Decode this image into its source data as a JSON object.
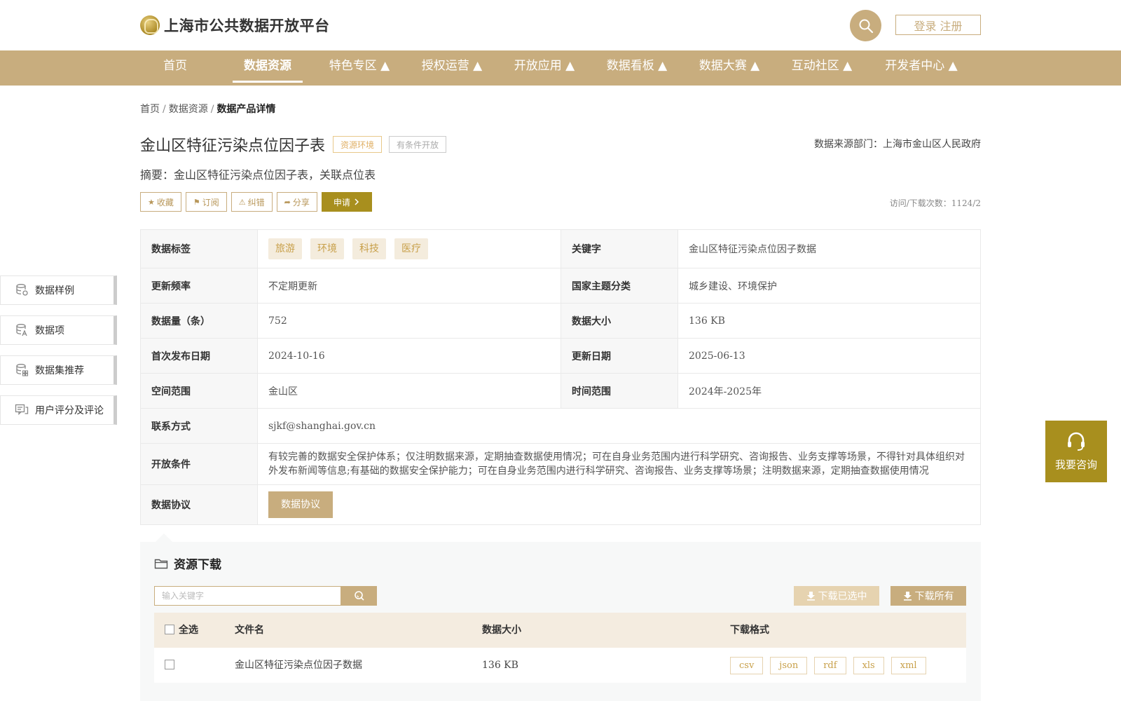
{
  "header": {
    "site_title": "上海市公共数据开放平台",
    "login_label": "登录 注册"
  },
  "nav": {
    "items": [
      "首页",
      "数据资源",
      "特色专区 ▲",
      "授权运营 ▲",
      "开放应用 ▲",
      "数据看板 ▲",
      "数据大赛 ▲",
      "互动社区 ▲",
      "开发者中心 ▲"
    ],
    "active_index": 1
  },
  "breadcrumb": {
    "home": "首页",
    "sep": "/",
    "level2": "数据资源",
    "current": "数据产品详情"
  },
  "product": {
    "title": "金山区特征污染点位因子表",
    "tag_topic": "资源环境",
    "tag_open": "有条件开放",
    "source_dept": "数据来源部门：上海市金山区人民政府",
    "summary": "摘要：金山区特征污染点位因子表，关联点位表",
    "visits": "访问/下载次数：1124/2"
  },
  "actions": {
    "favorite": "收藏",
    "subscribe": "订阅",
    "report": "纠错",
    "share": "分享",
    "apply": "申请"
  },
  "info": {
    "tags_label": "数据标签",
    "tags": [
      "旅游",
      "环境",
      "科技",
      "医疗"
    ],
    "keyword_label": "关键字",
    "keyword": "金山区特征污染点位因子数据",
    "freq_label": "更新频率",
    "freq": "不定期更新",
    "theme_label": "国家主题分类",
    "theme": "城乡建设、环境保护",
    "count_label": "数据量（条）",
    "count": "752",
    "size_label": "数据大小",
    "size": "136 KB",
    "first_pub_label": "首次发布日期",
    "first_pub": "2024-10-16",
    "update_label": "更新日期",
    "update": "2025-06-13",
    "space_label": "空间范围",
    "space": "金山区",
    "time_label": "时间范围",
    "time": "2024年-2025年",
    "contact_label": "联系方式",
    "contact": "sjkf@shanghai.gov.cn",
    "condition_label": "开放条件",
    "condition": "有较完善的数据安全保护体系；仅注明数据来源，定期抽查数据使用情况；可在自身业务范围内进行科学研究、咨询报告、业务支撑等场景，不得针对具体组织对外发布新闻等信息;有基础的数据安全保护能力；可在自身业务范围内进行科学研究、咨询报告、业务支撑等场景；注明数据来源，定期抽查数据使用情况",
    "protocol_label": "数据协议",
    "protocol_btn": "数据协议"
  },
  "sidebar": {
    "items": [
      "数据样例",
      "数据项",
      "数据集推荐",
      "用户评分及评论"
    ]
  },
  "consult": {
    "label": "我要咨询"
  },
  "download": {
    "title": "资源下载",
    "search_placeholder": "输入关键字",
    "download_selected": "下载已选中",
    "download_all": "下载所有",
    "columns": [
      "全选",
      "文件名",
      "数据大小",
      "下载格式"
    ],
    "rows": [
      {
        "name": "金山区特征污染点位因子数据",
        "size": "136 KB",
        "formats": [
          "csv",
          "json",
          "rdf",
          "xls",
          "xml"
        ]
      }
    ]
  },
  "colors": {
    "brand_gold": "#c8ad7e",
    "accent_olive": "#a88f1e"
  }
}
